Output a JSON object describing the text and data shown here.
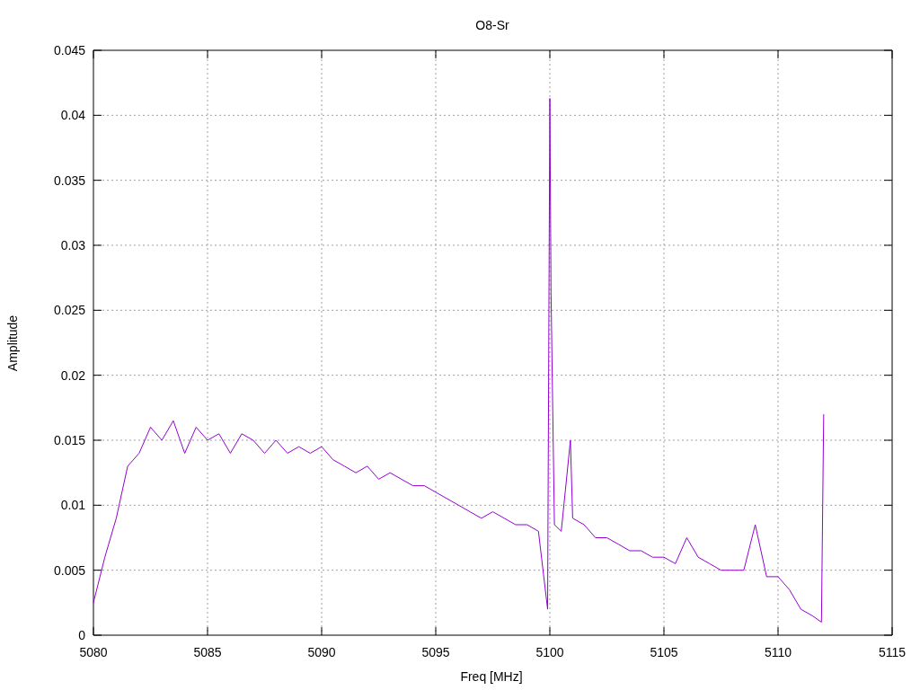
{
  "chart_data": {
    "type": "line",
    "grid": true,
    "title": "O8-Sr",
    "xlabel": "Freq [MHz]",
    "ylabel": "Amplitude",
    "xlim": [
      5080,
      5115
    ],
    "ylim": [
      0,
      0.045
    ],
    "xticks": [
      5080,
      5085,
      5090,
      5095,
      5100,
      5105,
      5110,
      5115
    ],
    "yticks": [
      0,
      0.005,
      0.01,
      0.015,
      0.02,
      0.025,
      0.03,
      0.035,
      0.04,
      0.045
    ],
    "x": [
      5080,
      5080.5,
      5081,
      5081.5,
      5082,
      5082.5,
      5083,
      5083.5,
      5084,
      5084.5,
      5085,
      5085.5,
      5086,
      5086.5,
      5087,
      5087.5,
      5088,
      5088.5,
      5089,
      5089.5,
      5090,
      5090.5,
      5091,
      5091.5,
      5092,
      5092.5,
      5093,
      5093.5,
      5094,
      5094.5,
      5095,
      5095.5,
      5096,
      5096.5,
      5097,
      5097.5,
      5098,
      5098.5,
      5099,
      5099.5,
      5099.9,
      5100,
      5100.05,
      5100.2,
      5100.5,
      5100.9,
      5101,
      5101.5,
      5102,
      5102.5,
      5103,
      5103.5,
      5104,
      5104.5,
      5105,
      5105.5,
      5106,
      5106.5,
      5107,
      5107.5,
      5108,
      5108.5,
      5109,
      5109.5,
      5110,
      5110.5,
      5111,
      5111.5,
      5111.9,
      5112
    ],
    "series": [
      {
        "color": "#9400d3",
        "values": [
          0.0025,
          0.006,
          0.009,
          0.013,
          0.014,
          0.016,
          0.015,
          0.0165,
          0.014,
          0.016,
          0.015,
          0.0155,
          0.014,
          0.0155,
          0.015,
          0.014,
          0.015,
          0.014,
          0.0145,
          0.014,
          0.0145,
          0.0135,
          0.013,
          0.0125,
          0.013,
          0.012,
          0.0125,
          0.012,
          0.0115,
          0.0115,
          0.011,
          0.0105,
          0.01,
          0.0095,
          0.009,
          0.0095,
          0.009,
          0.0085,
          0.0085,
          0.008,
          0.002,
          0.0413,
          0.0264,
          0.0085,
          0.008,
          0.015,
          0.009,
          0.0085,
          0.0075,
          0.0075,
          0.007,
          0.0065,
          0.0065,
          0.006,
          0.006,
          0.0055,
          0.0075,
          0.006,
          0.0055,
          0.005,
          0.005,
          0.005,
          0.0085,
          0.0045,
          0.0045,
          0.0035,
          0.002,
          0.0015,
          0.001,
          0.017
        ]
      }
    ]
  }
}
